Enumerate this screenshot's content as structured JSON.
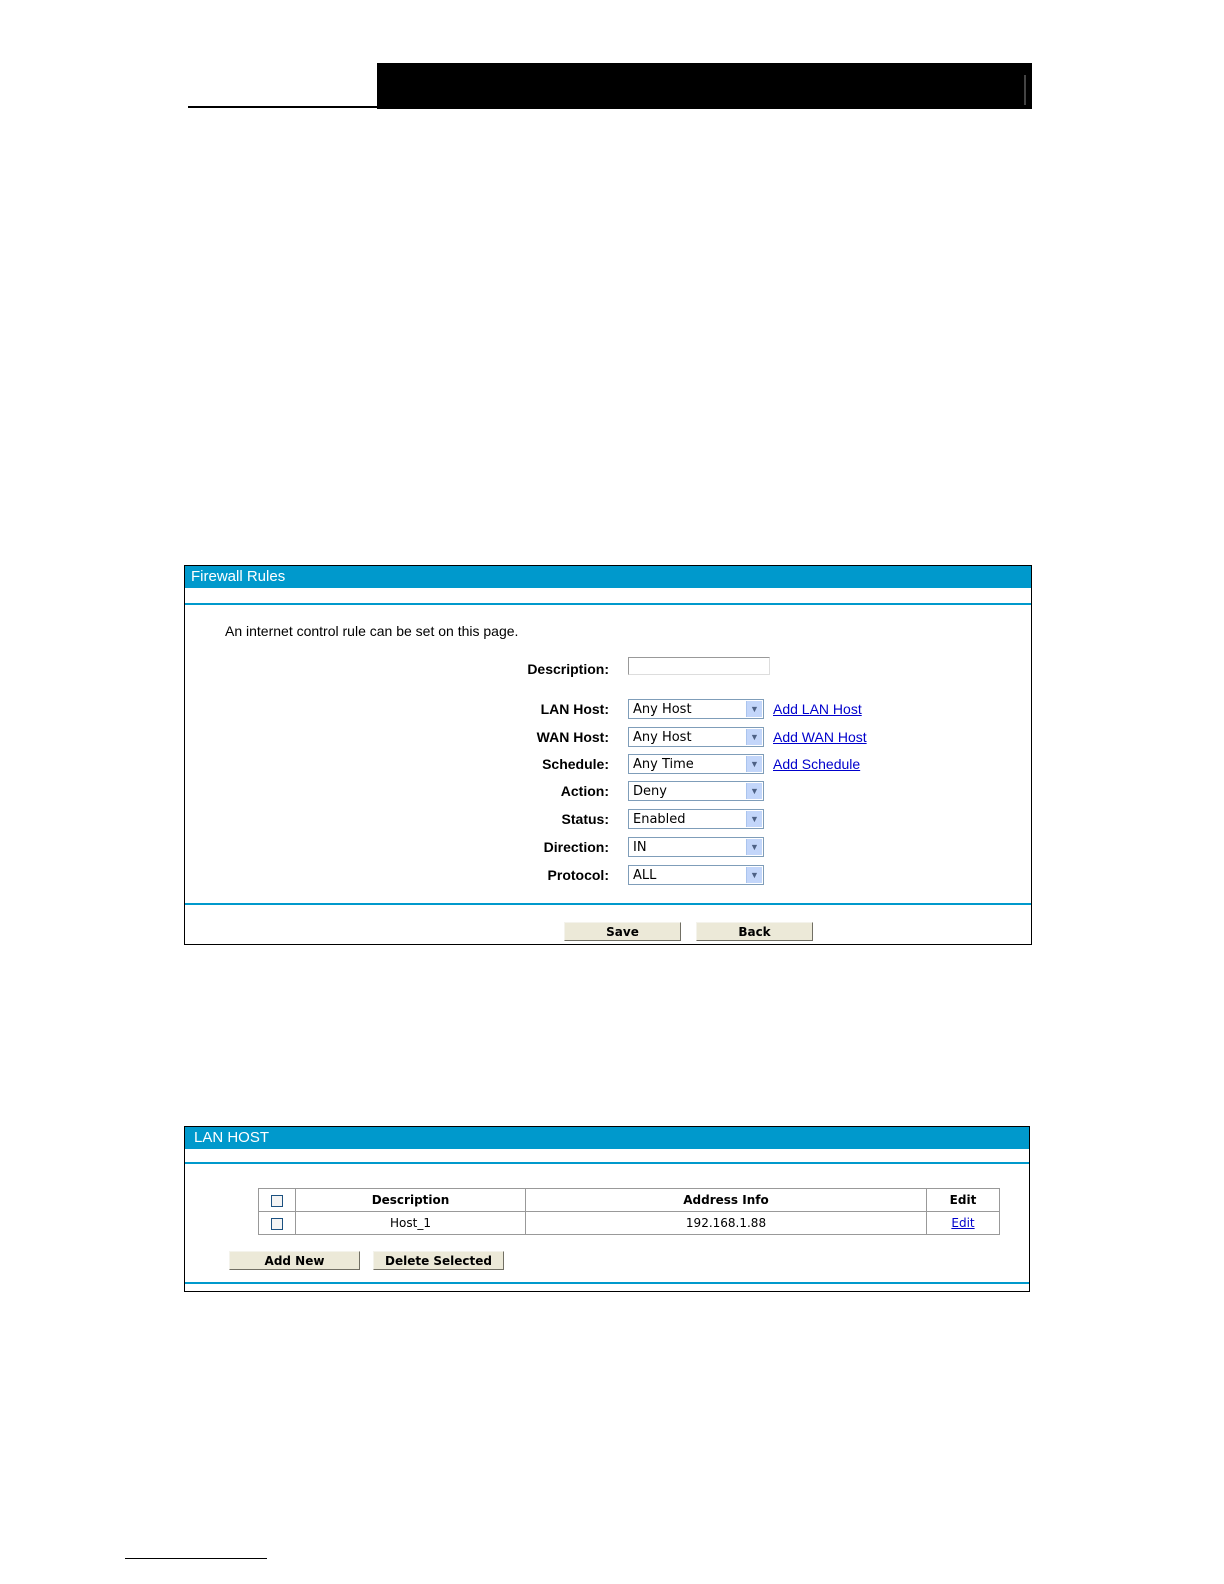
{
  "firewall_rules": {
    "title": "Firewall Rules",
    "intro": "An internet control rule can be set on this page.",
    "fields": {
      "description": {
        "label": "Description:",
        "value": ""
      },
      "lan_host": {
        "label": "LAN Host:",
        "value": "Any Host",
        "link": "Add LAN Host"
      },
      "wan_host": {
        "label": "WAN Host:",
        "value": "Any Host",
        "link": "Add WAN Host"
      },
      "schedule": {
        "label": "Schedule:",
        "value": "Any Time",
        "link": "Add Schedule"
      },
      "action": {
        "label": "Action:",
        "value": "Deny"
      },
      "status": {
        "label": "Status:",
        "value": "Enabled"
      },
      "direction": {
        "label": "Direction:",
        "value": "IN"
      },
      "protocol": {
        "label": "Protocol:",
        "value": "ALL"
      }
    },
    "buttons": {
      "save": "Save",
      "back": "Back"
    }
  },
  "lan_host": {
    "title": "LAN HOST",
    "columns": {
      "description": "Description",
      "address": "Address Info",
      "edit": "Edit"
    },
    "rows": [
      {
        "description": "Host_1",
        "address": "192.168.1.88",
        "edit": "Edit"
      }
    ],
    "buttons": {
      "add_new": "Add New",
      "delete_selected": "Delete Selected"
    }
  },
  "colors": {
    "panel_header": "#0099cc",
    "link": "#0000cc",
    "button_face": "#ece9d8"
  }
}
